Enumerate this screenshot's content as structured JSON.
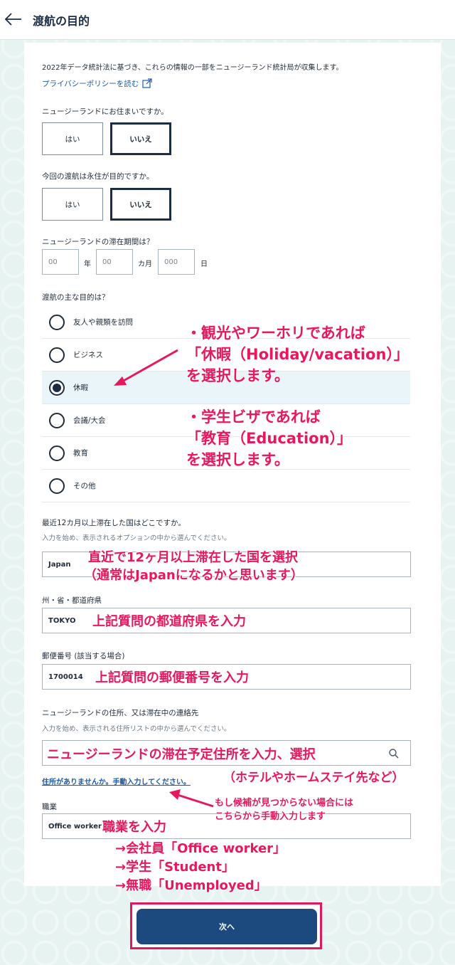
{
  "header": {
    "title": "渡航の目的"
  },
  "intro": {
    "statistics_notice": "2022年データ統計法に基づき、これらの情報の一部をニュージーランド統計局が収集します。",
    "privacy_link": "プライバシーポリシーを読む"
  },
  "q_reside": {
    "label": "ニュージーランドにお住まいですか。",
    "yes": "はい",
    "no": "いいえ"
  },
  "q_permanent": {
    "label": "今回の渡航は永住が目的ですか。",
    "yes": "はい",
    "no": "いいえ"
  },
  "q_stay": {
    "label": "ニュージーランドの滞在期間は？",
    "years_placeholder": "00",
    "years_unit": "年",
    "months_placeholder": "00",
    "months_unit": "カ月",
    "days_placeholder": "000",
    "days_unit": "日"
  },
  "q_purpose": {
    "label": "渡航の主な目的は？",
    "options": [
      "友人や親類を訪問",
      "ビジネス",
      "休暇",
      "会議/大会",
      "教育",
      "その他"
    ],
    "selected": "休暇"
  },
  "q_country": {
    "label": "最近12カ月以上滞在した国はどこですか。",
    "hint": "入力を始め、表示されるオプションの中から選んでください。",
    "value": "Japan"
  },
  "q_state": {
    "label": "州・省・都道府県",
    "value": "TOKYO"
  },
  "q_postcode": {
    "label": "郵便番号 (該当する場合)",
    "value": "1700014"
  },
  "q_address": {
    "label": "ニュージーランドの住所、又は滞在中の連絡先",
    "hint": "入力を始め、表示される住所リストの中から選んでください。",
    "manual_link": "住所がありませんか。手動入力してください。"
  },
  "q_occupation": {
    "label": "職業",
    "value": "Office worker"
  },
  "next_button": "次へ",
  "annotations": {
    "purpose_holiday": [
      "・観光やワーホリであれば",
      "「休暇（Holiday/vacation）」",
      "を選択します。"
    ],
    "purpose_education": [
      "・学生ビザであれば",
      "「教育（Education）」",
      "を選択します。"
    ],
    "country": [
      "直近で12ヶ月以上滞在した国を選択",
      "（通常はJapanになるかと思います）"
    ],
    "state": "上記質問の都道府県を入力",
    "postcode": "上記質問の郵便番号を入力",
    "address": "ニュージーランドの滞在予定住所を入力、選択",
    "address_example": "（ホテルやホームステイ先など）",
    "manual": [
      "もし候補が見つからない場合には",
      "こちらから手動入力します"
    ],
    "occupation": [
      "職業を入力",
      "→会社員「Office worker」",
      "→学生「Student」",
      "→無職「Unemployed」"
    ]
  },
  "colors": {
    "accent": "#e8185e",
    "primary": "#1d4a7e",
    "text": "#1a2c46"
  }
}
